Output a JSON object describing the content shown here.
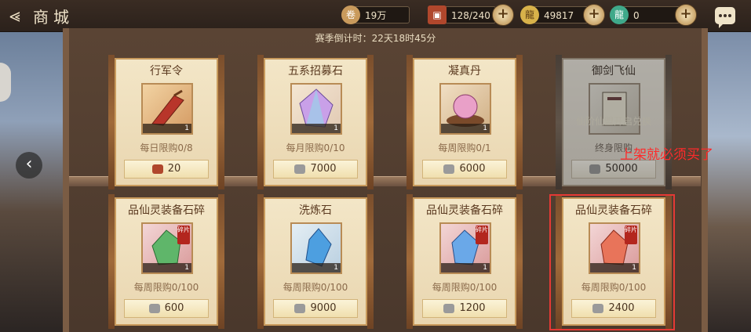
{
  "header": {
    "title": "商城",
    "resources": [
      {
        "icon": "scroll-icon",
        "value": "19万"
      },
      {
        "icon": "chest-icon",
        "value": "128/240"
      },
      {
        "icon": "gold-dragon-icon",
        "value": "49817"
      },
      {
        "icon": "jade-dragon-icon",
        "value": "0"
      }
    ]
  },
  "countdown": "赛季倒计时：22天18时45分",
  "items": [
    {
      "name": "行军令",
      "qty": "1",
      "limit": "每日限购0/8",
      "price": "20",
      "price_icon": "chest-icon"
    },
    {
      "name": "五系招募石",
      "qty": "1",
      "limit": "每月限购0/10",
      "price": "7000",
      "price_icon": "silver-icon"
    },
    {
      "name": "凝真丹",
      "qty": "1",
      "limit": "每周限购0/1",
      "price": "6000",
      "price_icon": "silver-icon"
    },
    {
      "name": "御剑飞仙",
      "qty": "",
      "limit": "终身限购",
      "price": "50000",
      "price_icon": "silver-icon",
      "locked_note": "仙阶仙盟开启兑换"
    },
    {
      "name": "品仙灵装备石碎",
      "qty": "1",
      "limit": "每周限购0/100",
      "price": "600",
      "price_icon": "silver-icon",
      "tag": "碎片"
    },
    {
      "name": "洗炼石",
      "qty": "1",
      "limit": "每周限购0/100",
      "price": "9000",
      "price_icon": "silver-icon"
    },
    {
      "name": "品仙灵装备石碎",
      "qty": "1",
      "limit": "每周限购0/100",
      "price": "1200",
      "price_icon": "silver-icon",
      "tag": "碎片"
    },
    {
      "name": "品仙灵装备石碎",
      "qty": "1",
      "limit": "每周限购0/100",
      "price": "2400",
      "price_icon": "silver-icon",
      "tag": "碎片"
    }
  ],
  "annotation": "上架就必须买了",
  "colors": {
    "accent": "#c89a5c",
    "annotation_red": "#e53935"
  }
}
